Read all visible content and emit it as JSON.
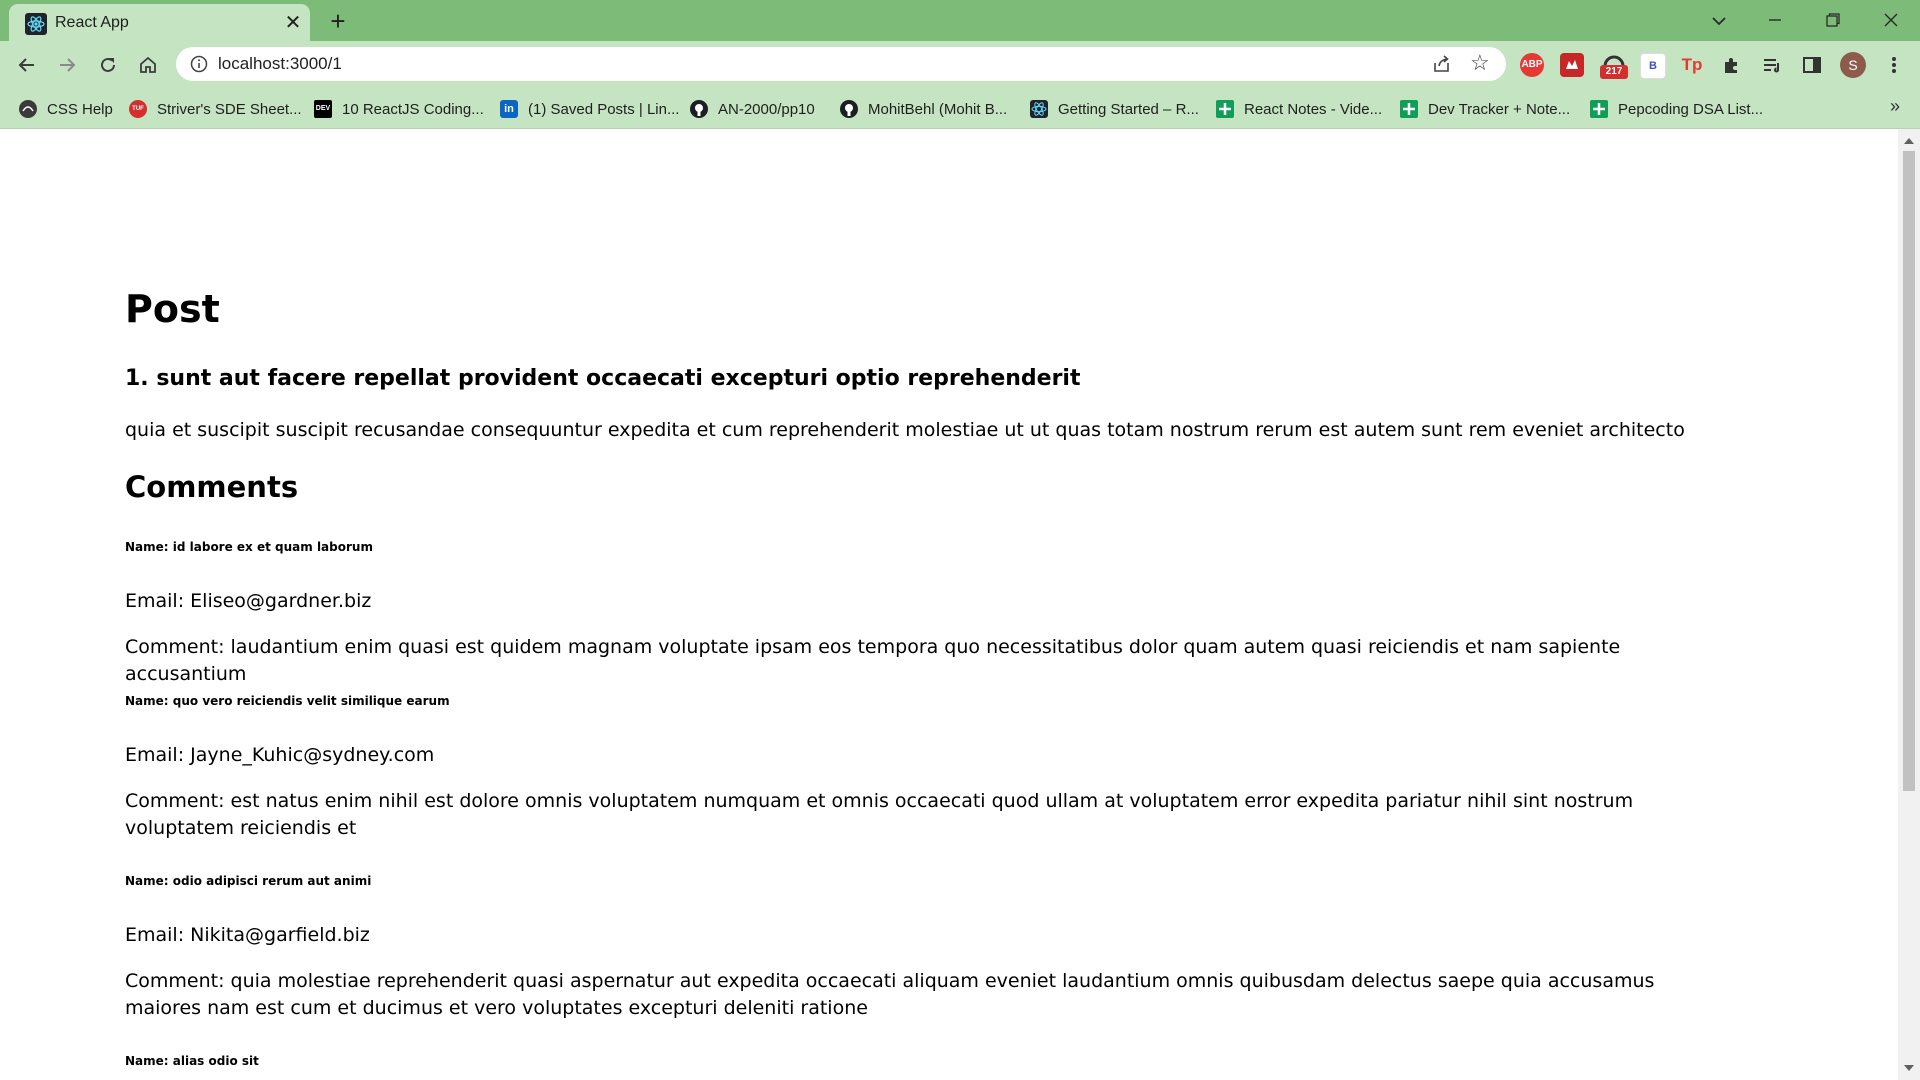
{
  "tab": {
    "title": "React App"
  },
  "address_bar": {
    "url": "localhost:3000/1"
  },
  "extensions": {
    "adblock_label": "ABP",
    "badge_count": "217",
    "b_label": "B",
    "tp_label": "Tp",
    "profile_initial": "S"
  },
  "bookmarks": [
    {
      "label": "CSS Help",
      "icon": "css-help-icon"
    },
    {
      "label": "Striver's SDE Sheet...",
      "icon": "striver-icon"
    },
    {
      "label": "10 ReactJS Coding...",
      "icon": "dev-icon"
    },
    {
      "label": "(1) Saved Posts | Lin...",
      "icon": "linkedin-icon"
    },
    {
      "label": "AN-2000/pp10",
      "icon": "github-icon"
    },
    {
      "label": "MohitBehl (Mohit B...",
      "icon": "github-icon"
    },
    {
      "label": "Getting Started – R...",
      "icon": "react-icon"
    },
    {
      "label": "React Notes - Vide...",
      "icon": "sheets-icon"
    },
    {
      "label": "Dev Tracker + Note...",
      "icon": "sheets-icon"
    },
    {
      "label": "Pepcoding DSA List...",
      "icon": "sheets-icon"
    }
  ],
  "page": {
    "heading": "Post",
    "post_title": "1. sunt aut facere repellat provident occaecati excepturi optio reprehenderit",
    "post_body": "quia et suscipit suscipit recusandae consequuntur expedita et cum reprehenderit molestiae ut ut quas totam nostrum rerum est autem sunt rem eveniet architecto",
    "comments_heading": "Comments",
    "comments": [
      {
        "name": "Name: id labore ex et quam laborum",
        "email": "Email: Eliseo@gardner.biz",
        "body": "Comment: laudantium enim quasi est quidem magnam voluptate ipsam eos tempora quo necessitatibus dolor quam autem quasi reiciendis et nam sapiente accusantium"
      },
      {
        "name": "Name: quo vero reiciendis velit similique earum",
        "email": "Email: Jayne_Kuhic@sydney.com",
        "body": "Comment: est natus enim nihil est dolore omnis voluptatem numquam et omnis occaecati quod ullam at voluptatem error expedita pariatur nihil sint nostrum voluptatem reiciendis et"
      },
      {
        "name": "Name: odio adipisci rerum aut animi",
        "email": "Email: Nikita@garfield.biz",
        "body": "Comment: quia molestiae reprehenderit quasi aspernatur aut expedita occaecati aliquam eveniet laudantium omnis quibusdam delectus saepe quia accusamus maiores nam est cum et ducimus et vero voluptates excepturi deleniti ratione"
      },
      {
        "name": "Name: alias odio sit"
      }
    ]
  },
  "colors": {
    "chrome_green": "#7cbb78",
    "toolbar_green": "#c5e4c2"
  }
}
